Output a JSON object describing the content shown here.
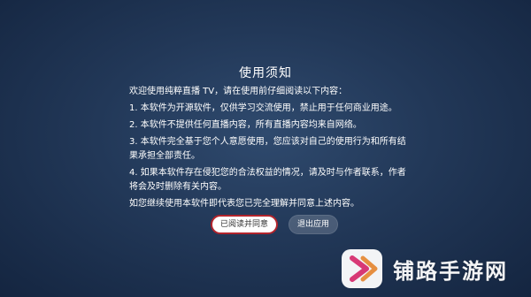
{
  "dialog": {
    "title": "使用须知",
    "lines": [
      "欢迎使用纯粹直播 TV，请在使用前仔细阅读以下内容：",
      "1. 本软件为开源软件，仅供学习交流使用，禁止用于任何商业用途。",
      "2. 本软件不提供任何直播内容，所有直播内容均来自网络。",
      "3. 本软件完全基于您个人意愿使用，您应该对自己的使用行为和所有结果承担全部责任。",
      "4. 如果本软件存在侵犯您的合法权益的情况，请及时与作者联系，作者将会及时删除有关内容。",
      "如您继续使用本软件即代表您已完全理解并同意上述内容。"
    ],
    "agree_label": "已阅读并同意",
    "exit_label": "退出应用"
  },
  "watermark": {
    "text": "铺路手游网",
    "logo_icon": "arrow-chevron-logo-icon"
  },
  "colors": {
    "background": "#223858",
    "agree_border": "#b3242c",
    "logo_accent": "#e23a78"
  }
}
